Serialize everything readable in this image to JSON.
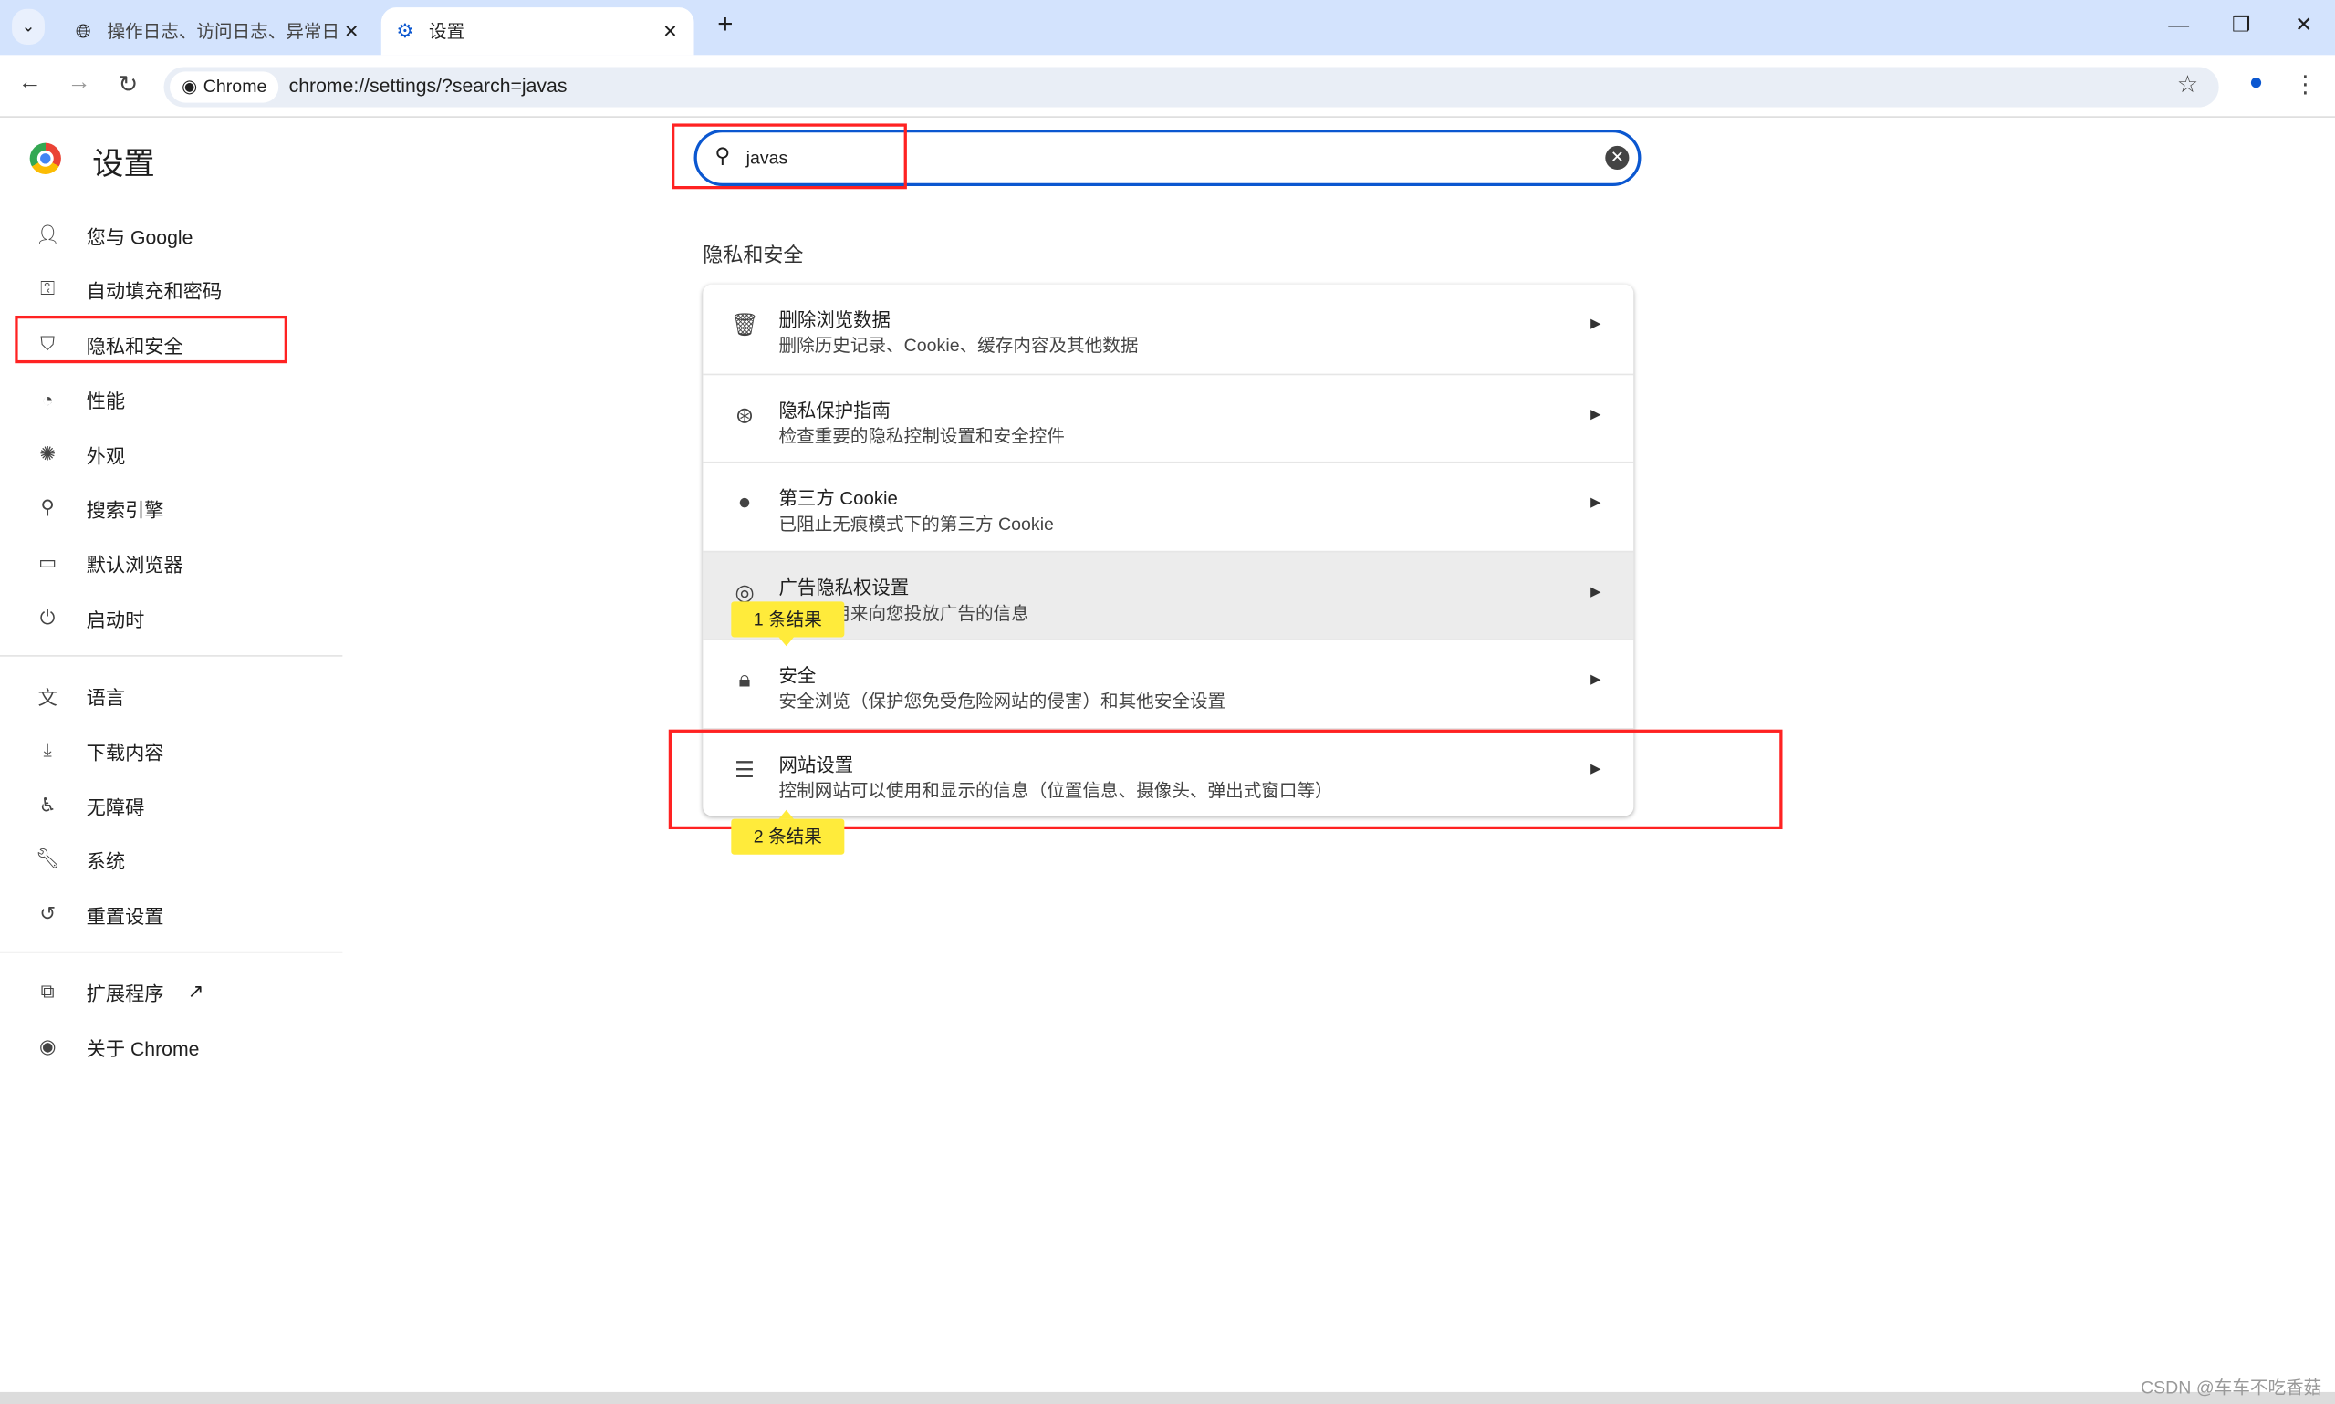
{
  "browser": {
    "tabs": [
      {
        "title": "操作日志、访问日志、异常日志",
        "icon": "globe-icon",
        "active": false
      },
      {
        "title": "设置",
        "icon": "gear-icon",
        "active": true
      }
    ],
    "url": "chrome://settings/?search=javas",
    "site_chip": "Chrome"
  },
  "sidebar": {
    "title": "设置",
    "items": [
      {
        "label": "您与 Google",
        "icon": "person-icon"
      },
      {
        "label": "自动填充和密码",
        "icon": "key-icon"
      },
      {
        "label": "隐私和安全",
        "icon": "shield-icon",
        "highlighted": true
      },
      {
        "label": "性能",
        "icon": "speedometer-icon"
      },
      {
        "label": "外观",
        "icon": "palette-icon"
      },
      {
        "label": "搜索引擎",
        "icon": "search-icon"
      },
      {
        "label": "默认浏览器",
        "icon": "browser-icon"
      },
      {
        "label": "启动时",
        "icon": "power-icon"
      },
      {
        "label": "语言",
        "icon": "translate-icon"
      },
      {
        "label": "下载内容",
        "icon": "download-icon"
      },
      {
        "label": "无障碍",
        "icon": "accessibility-icon"
      },
      {
        "label": "系统",
        "icon": "wrench-icon"
      },
      {
        "label": "重置设置",
        "icon": "reset-icon"
      },
      {
        "label": "扩展程序",
        "icon": "extension-icon"
      },
      {
        "label": "关于 Chrome",
        "icon": "chrome-icon"
      }
    ]
  },
  "search": {
    "value": "javas"
  },
  "section": {
    "title": "隐私和安全",
    "rows": [
      {
        "title": "删除浏览数据",
        "subtitle": "删除历史记录、Cookie、缓存内容及其他数据",
        "icon": "trash-icon"
      },
      {
        "title": "隐私保护指南",
        "subtitle": "检查重要的隐私控制设置和安全控件",
        "icon": "privacy-guide-icon"
      },
      {
        "title": "第三方 Cookie",
        "subtitle": "已阻止无痕模式下的第三方 Cookie",
        "icon": "cookie-icon"
      },
      {
        "title": "广告隐私权设置",
        "subtitle": "网站可用来向您投放广告的信息",
        "icon": "ad-privacy-icon",
        "hovered": true
      },
      {
        "title": "安全",
        "subtitle": "安全浏览（保护您免受危险网站的侵害）和其他安全设置",
        "icon": "lock-icon"
      },
      {
        "title": "网站设置",
        "subtitle": "控制网站可以使用和显示的信息（位置信息、摄像头、弹出式窗口等）",
        "icon": "tune-icon"
      }
    ]
  },
  "bubbles": [
    "1 条结果",
    "2 条结果"
  ],
  "watermark": "CSDN @车车不吃香菇",
  "colors": {
    "accent": "#0b57d0",
    "tabstrip": "#d3e3fd",
    "highlight": "#ffeb3b",
    "annotation": "#ff2222"
  }
}
